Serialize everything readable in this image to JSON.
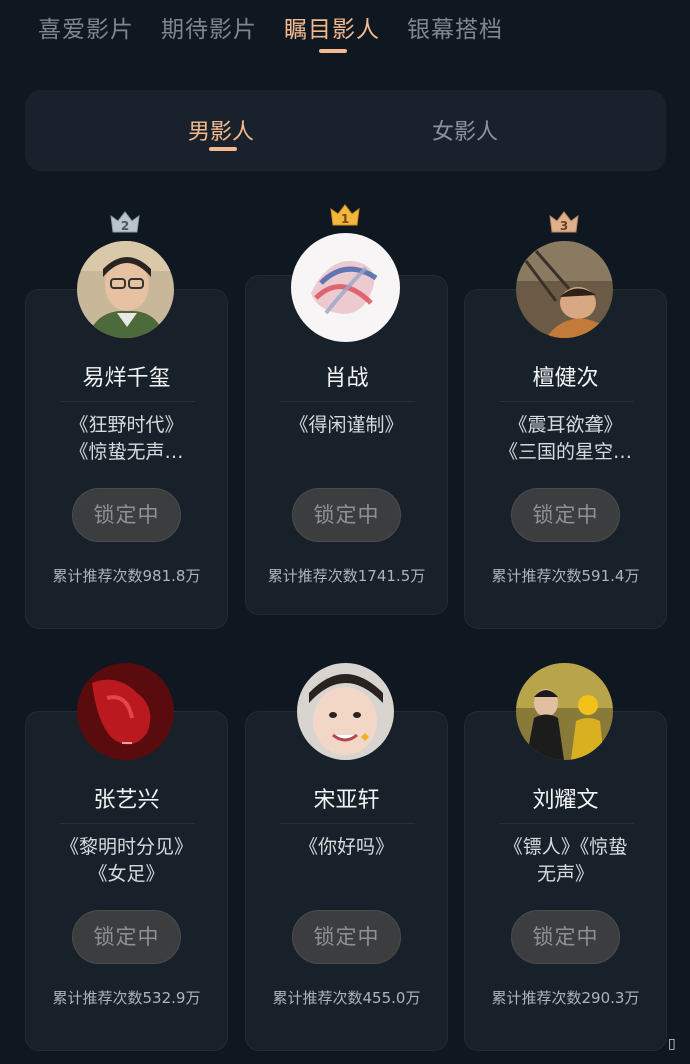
{
  "top_tabs": [
    {
      "label": "喜爱影片",
      "active": false
    },
    {
      "label": "期待影片",
      "active": false
    },
    {
      "label": "瞩目影人",
      "active": true
    },
    {
      "label": "银幕搭档",
      "active": false
    }
  ],
  "gender_tabs": [
    {
      "label": "男影人",
      "active": true
    },
    {
      "label": "女影人",
      "active": false
    }
  ],
  "accent_color": "#f4b98e",
  "people": [
    {
      "rank": "2",
      "name": "易烊千玺",
      "works": [
        "《狂野时代》",
        "《惊蛰无声…"
      ],
      "button": "锁定中",
      "count": "累计推荐次数981.8万"
    },
    {
      "rank": "1",
      "name": "肖战",
      "works": [
        "《得闲谨制》"
      ],
      "button": "锁定中",
      "count": "累计推荐次数1741.5万"
    },
    {
      "rank": "3",
      "name": "檀健次",
      "works": [
        "《震耳欲聋》",
        "《三国的星空…"
      ],
      "button": "锁定中",
      "count": "累计推荐次数591.4万"
    },
    {
      "rank": "",
      "name": "张艺兴",
      "works": [
        "《黎明时分见》",
        "《女足》"
      ],
      "button": "锁定中",
      "count": "累计推荐次数532.9万"
    },
    {
      "rank": "",
      "name": "宋亚轩",
      "works": [
        "《你好吗》"
      ],
      "button": "锁定中",
      "count": "累计推荐次数455.0万"
    },
    {
      "rank": "",
      "name": "刘耀文",
      "works": [
        "《镖人》《惊蛰",
        "无声》"
      ],
      "button": "锁定中",
      "count": "累计推荐次数290.3万"
    }
  ]
}
